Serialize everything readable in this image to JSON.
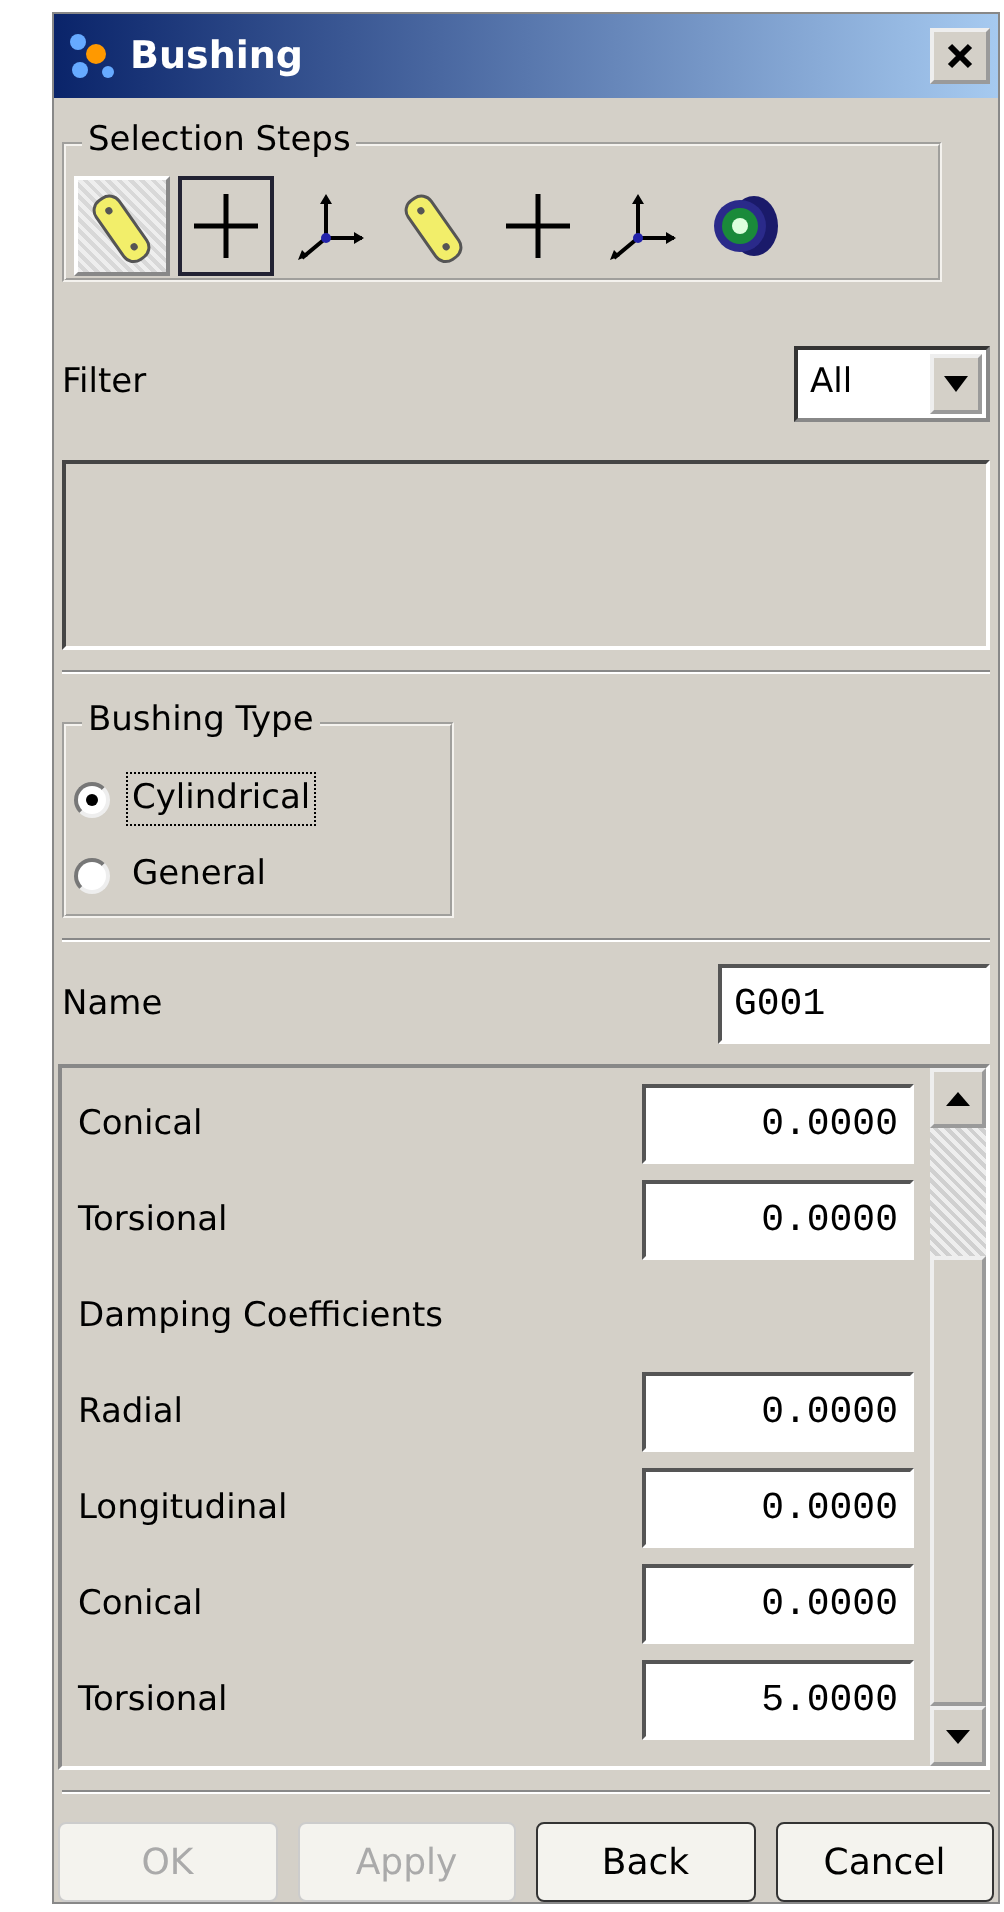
{
  "window": {
    "title": "Bushing"
  },
  "selection_steps": {
    "label": "Selection Steps",
    "steps": [
      {
        "kind": "link",
        "selected": true,
        "focused": false
      },
      {
        "kind": "point",
        "selected": false,
        "focused": true
      },
      {
        "kind": "csys",
        "selected": false,
        "focused": false
      },
      {
        "kind": "link",
        "selected": false,
        "focused": false
      },
      {
        "kind": "point",
        "selected": false,
        "focused": false
      },
      {
        "kind": "csys",
        "selected": false,
        "focused": false
      },
      {
        "kind": "bushing",
        "selected": false,
        "focused": false
      }
    ]
  },
  "filter": {
    "label": "Filter",
    "value": "All"
  },
  "bushing_type": {
    "label": "Bushing Type",
    "options": [
      {
        "label": "Cylindrical",
        "selected": true,
        "focused": true
      },
      {
        "label": "General",
        "selected": false,
        "focused": false
      }
    ]
  },
  "name": {
    "label": "Name",
    "value": "G001"
  },
  "parameters": [
    {
      "kind": "field",
      "label": "Conical",
      "value": "0.0000"
    },
    {
      "kind": "field",
      "label": "Torsional",
      "value": "0.0000"
    },
    {
      "kind": "heading",
      "label": "Damping Coefficients"
    },
    {
      "kind": "field",
      "label": "Radial",
      "value": "0.0000"
    },
    {
      "kind": "field",
      "label": "Longitudinal",
      "value": "0.0000"
    },
    {
      "kind": "field",
      "label": "Conical",
      "value": "0.0000"
    },
    {
      "kind": "field",
      "label": "Torsional",
      "value": "5.0000"
    }
  ],
  "buttons": [
    {
      "label": "OK",
      "disabled": true
    },
    {
      "label": "Apply",
      "disabled": true
    },
    {
      "label": "Back",
      "disabled": false
    },
    {
      "label": "Cancel",
      "disabled": false
    }
  ]
}
